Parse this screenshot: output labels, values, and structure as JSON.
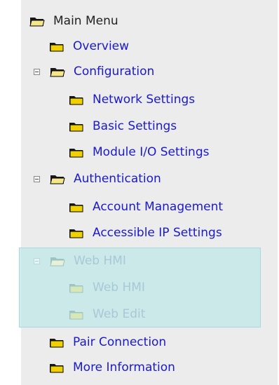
{
  "menu": {
    "root_label": "Main Menu",
    "items": [
      {
        "label": "Overview"
      },
      {
        "label": "Configuration"
      },
      {
        "label": "Network Settings"
      },
      {
        "label": "Basic Settings"
      },
      {
        "label": "Module I/O Settings"
      },
      {
        "label": "Authentication"
      },
      {
        "label": "Account Management"
      },
      {
        "label": "Accessible IP Settings"
      },
      {
        "label": "Web HMI"
      },
      {
        "label": "Web HMI"
      },
      {
        "label": "Web Edit"
      },
      {
        "label": "Pair Connection"
      },
      {
        "label": "More Information"
      }
    ]
  },
  "colors": {
    "link": "#1a1acc",
    "root_text": "#222222",
    "disabled_text": "#a8c8d8",
    "panel_bg": "#ececec",
    "highlight_bg": "#bee8e8",
    "folder_yellow": "#f0d000",
    "folder_outline": "#000000"
  },
  "icons": {
    "folder": "folder-icon",
    "folder_open": "folder-open-icon",
    "collapse": "collapse-toggle-icon"
  }
}
